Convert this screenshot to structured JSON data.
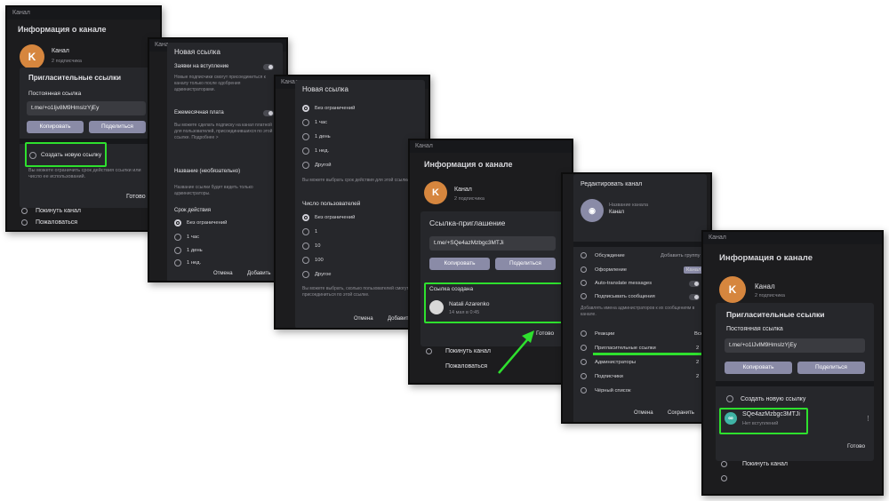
{
  "s1": {
    "topbar": "Канал",
    "title": "Информация о канале",
    "avatar_letter": "K",
    "channel": "Канал",
    "subs": "2 подписчика",
    "dialog_title": "Пригласительные ссылки",
    "permanent_link_label": "Постоянная ссылка",
    "link": "t.me/+o1Ijv8M9HmsIzYjEy",
    "copy": "Копировать",
    "share": "Поделиться",
    "create_new": "Создать новую ссылку",
    "hint": "Вы можете ограничить срок действия ссылки или число ее использований.",
    "done": "Готово",
    "leave": "Покинуть канал",
    "report": "Пожаловаться"
  },
  "s2": {
    "topbar": "Канал",
    "title": "Новая ссылка",
    "join_requests": "Заявки на вступление",
    "join_hint": "Новые подписчики смогут присоединиться к каналу только после одобрения администраторами.",
    "monthly_fee": "Ежемесячная плата",
    "fee_hint": "Вы можете сделать подписку на канал платной для пользователей, присоединившихся по этой ссылке. Подробнее >",
    "name_label": "Название (необязательно)",
    "name_hint": "Название ссылки будет видеть только администраторы.",
    "duration_label": "Срок действия",
    "options": [
      "Без ограничений",
      "1 час",
      "1 день",
      "1 нед."
    ],
    "cancel": "Отмена",
    "add": "Добавить"
  },
  "s3": {
    "topbar": "Канал",
    "title": "Новая ссылка",
    "duration_options": [
      "Без ограничений",
      "1 час",
      "1 день",
      "1 нед.",
      "Другой"
    ],
    "duration_hint": "Вы можете выбрать срок действия для этой ссылки.",
    "users_label": "Число пользователей",
    "user_options": [
      "Без ограничений",
      "1",
      "10",
      "100",
      "Другое"
    ],
    "users_hint": "Вы можете выбрать, сколько пользователей смогут присоединиться по этой ссылке.",
    "cancel": "Отмена",
    "add": "Добавить"
  },
  "s4": {
    "topbar": "Канал",
    "title": "Информация о канале",
    "avatar_letter": "K",
    "channel": "Канал",
    "subs": "2 подписчика",
    "dialog_title": "Ссылка-приглашение",
    "link": "t.me/+SQe4azMzbgc3MTJi",
    "copy": "Копировать",
    "share": "Поделиться",
    "created_label": "Ссылка создана",
    "creator": "Natali Azarenko",
    "created_time": "14 мая в 0:45",
    "done": "Готово",
    "leave": "Покинуть канал",
    "report": "Пожаловаться"
  },
  "s5": {
    "title": "Редактировать канал",
    "name_label": "Название канала",
    "name_value": "Канал",
    "items": [
      {
        "label": "Обсуждение",
        "value": "Добавить группу"
      },
      {
        "label": "Оформление",
        "value": "Канал"
      },
      {
        "label": "Auto-translate messages",
        "value": ""
      },
      {
        "label": "Подписывать сообщения",
        "value": ""
      }
    ],
    "sign_hint": "Добавлять имена администраторов к их сообщениям в канале.",
    "items2": [
      {
        "label": "Реакции",
        "value": "Все"
      },
      {
        "label": "Пригласительные ссылки",
        "value": "2"
      },
      {
        "label": "Администраторы",
        "value": "2"
      },
      {
        "label": "Подписчики",
        "value": "2"
      },
      {
        "label": "Чёрный список",
        "value": ""
      }
    ],
    "cancel": "Отмена",
    "save": "Сохранить"
  },
  "s6": {
    "topbar": "Канал",
    "title": "Информация о канале",
    "avatar_letter": "K",
    "channel": "Канал",
    "subs": "2 подписчика",
    "dialog_title": "Пригласительные ссылки",
    "permanent_link_label": "Постоянная ссылка",
    "link": "t.me/+o1IJvlM9HmsIzYjEy",
    "copy": "Копировать",
    "share": "Поделиться",
    "create_new": "Создать новую ссылку",
    "new_link": "SQe4azMzbgc3MTJi",
    "new_link_status": "Нет вступлений",
    "done": "Готово",
    "leave": "Покинуть канал"
  },
  "colors": {
    "highlight": "#2ee02e",
    "accent_button": "#8a8ba7",
    "avatar": "#d6863e",
    "link_icon": "#3fb3a5"
  }
}
